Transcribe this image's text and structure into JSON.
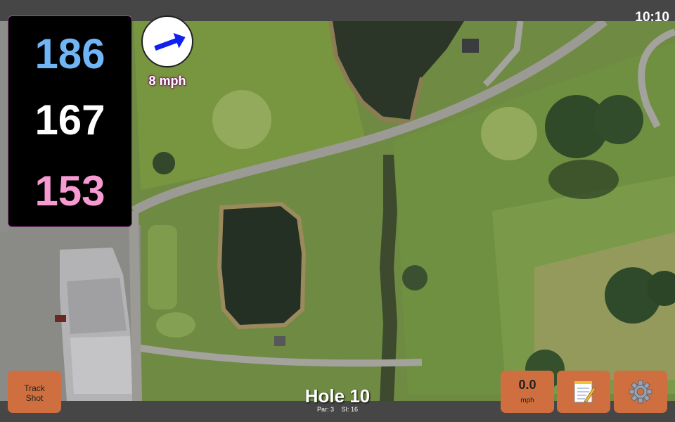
{
  "status_bar": {
    "time": "10:10"
  },
  "distances": {
    "back": "186",
    "middle": "167",
    "front": "153"
  },
  "wind": {
    "speed": "8 mph",
    "direction_icon": "arrow-icon"
  },
  "hole": {
    "title": "Hole 10",
    "par": "Par: 3",
    "stroke_index": "SI: 16"
  },
  "buttons": {
    "track_shot_line1": "Track",
    "track_shot_line2": "Shot",
    "speed_value": "0.0",
    "speed_unit": "mph",
    "notes_icon": "notepad-icon",
    "settings_icon": "gear-icon"
  },
  "colors": {
    "back_distance": "#70b6f6",
    "middle_distance": "#ffffff",
    "front_distance": "#f79ad2",
    "button": "#cf6f3f",
    "wind_arrow": "#1020ee"
  }
}
